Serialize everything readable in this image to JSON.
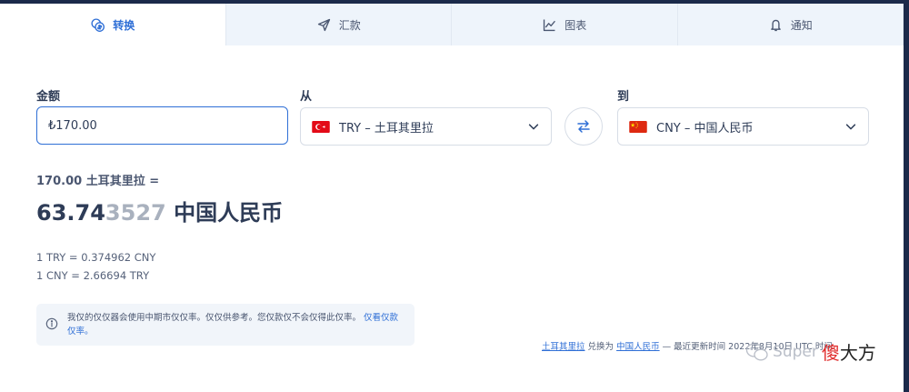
{
  "tabs": [
    {
      "label": "转换",
      "icon": "coins-icon",
      "active": true
    },
    {
      "label": "汇款",
      "icon": "send-icon",
      "active": false
    },
    {
      "label": "图表",
      "icon": "chart-line-icon",
      "active": false
    },
    {
      "label": "通知",
      "icon": "bell-icon",
      "active": false
    }
  ],
  "converter": {
    "amount_label": "金额",
    "amount_value": "₺170.00",
    "from_label": "从",
    "from_currency": "TRY – 土耳其里拉",
    "to_label": "到",
    "to_currency": "CNY – 中国人民币"
  },
  "result": {
    "source_line": "170.00 土耳其里拉 =",
    "value_main": "63.74",
    "value_faded": "3527",
    "currency_name": "中国人民币",
    "rate_forward": "1 TRY = 0.374962 CNY",
    "rate_reverse": "1 CNY = 2.66694 TRY"
  },
  "info": {
    "text": "我仅的仅仅器会使用中期市仅仅率。仅仅供参考。您仅款仅不会仅得此仅率。",
    "link": "仅看仅款仅率。"
  },
  "footer": {
    "from_link": "土耳其里拉",
    "mid": "兑换为",
    "to_link": "中国人民币",
    "tail": "— 最近更新时间 2022年8月10日 UTC 时间"
  },
  "watermark": {
    "text": "Super",
    "brand_a": "傻",
    "brand_b": "大方"
  },
  "colors": {
    "accent": "#2f6fd6",
    "text": "#2e3c57"
  }
}
